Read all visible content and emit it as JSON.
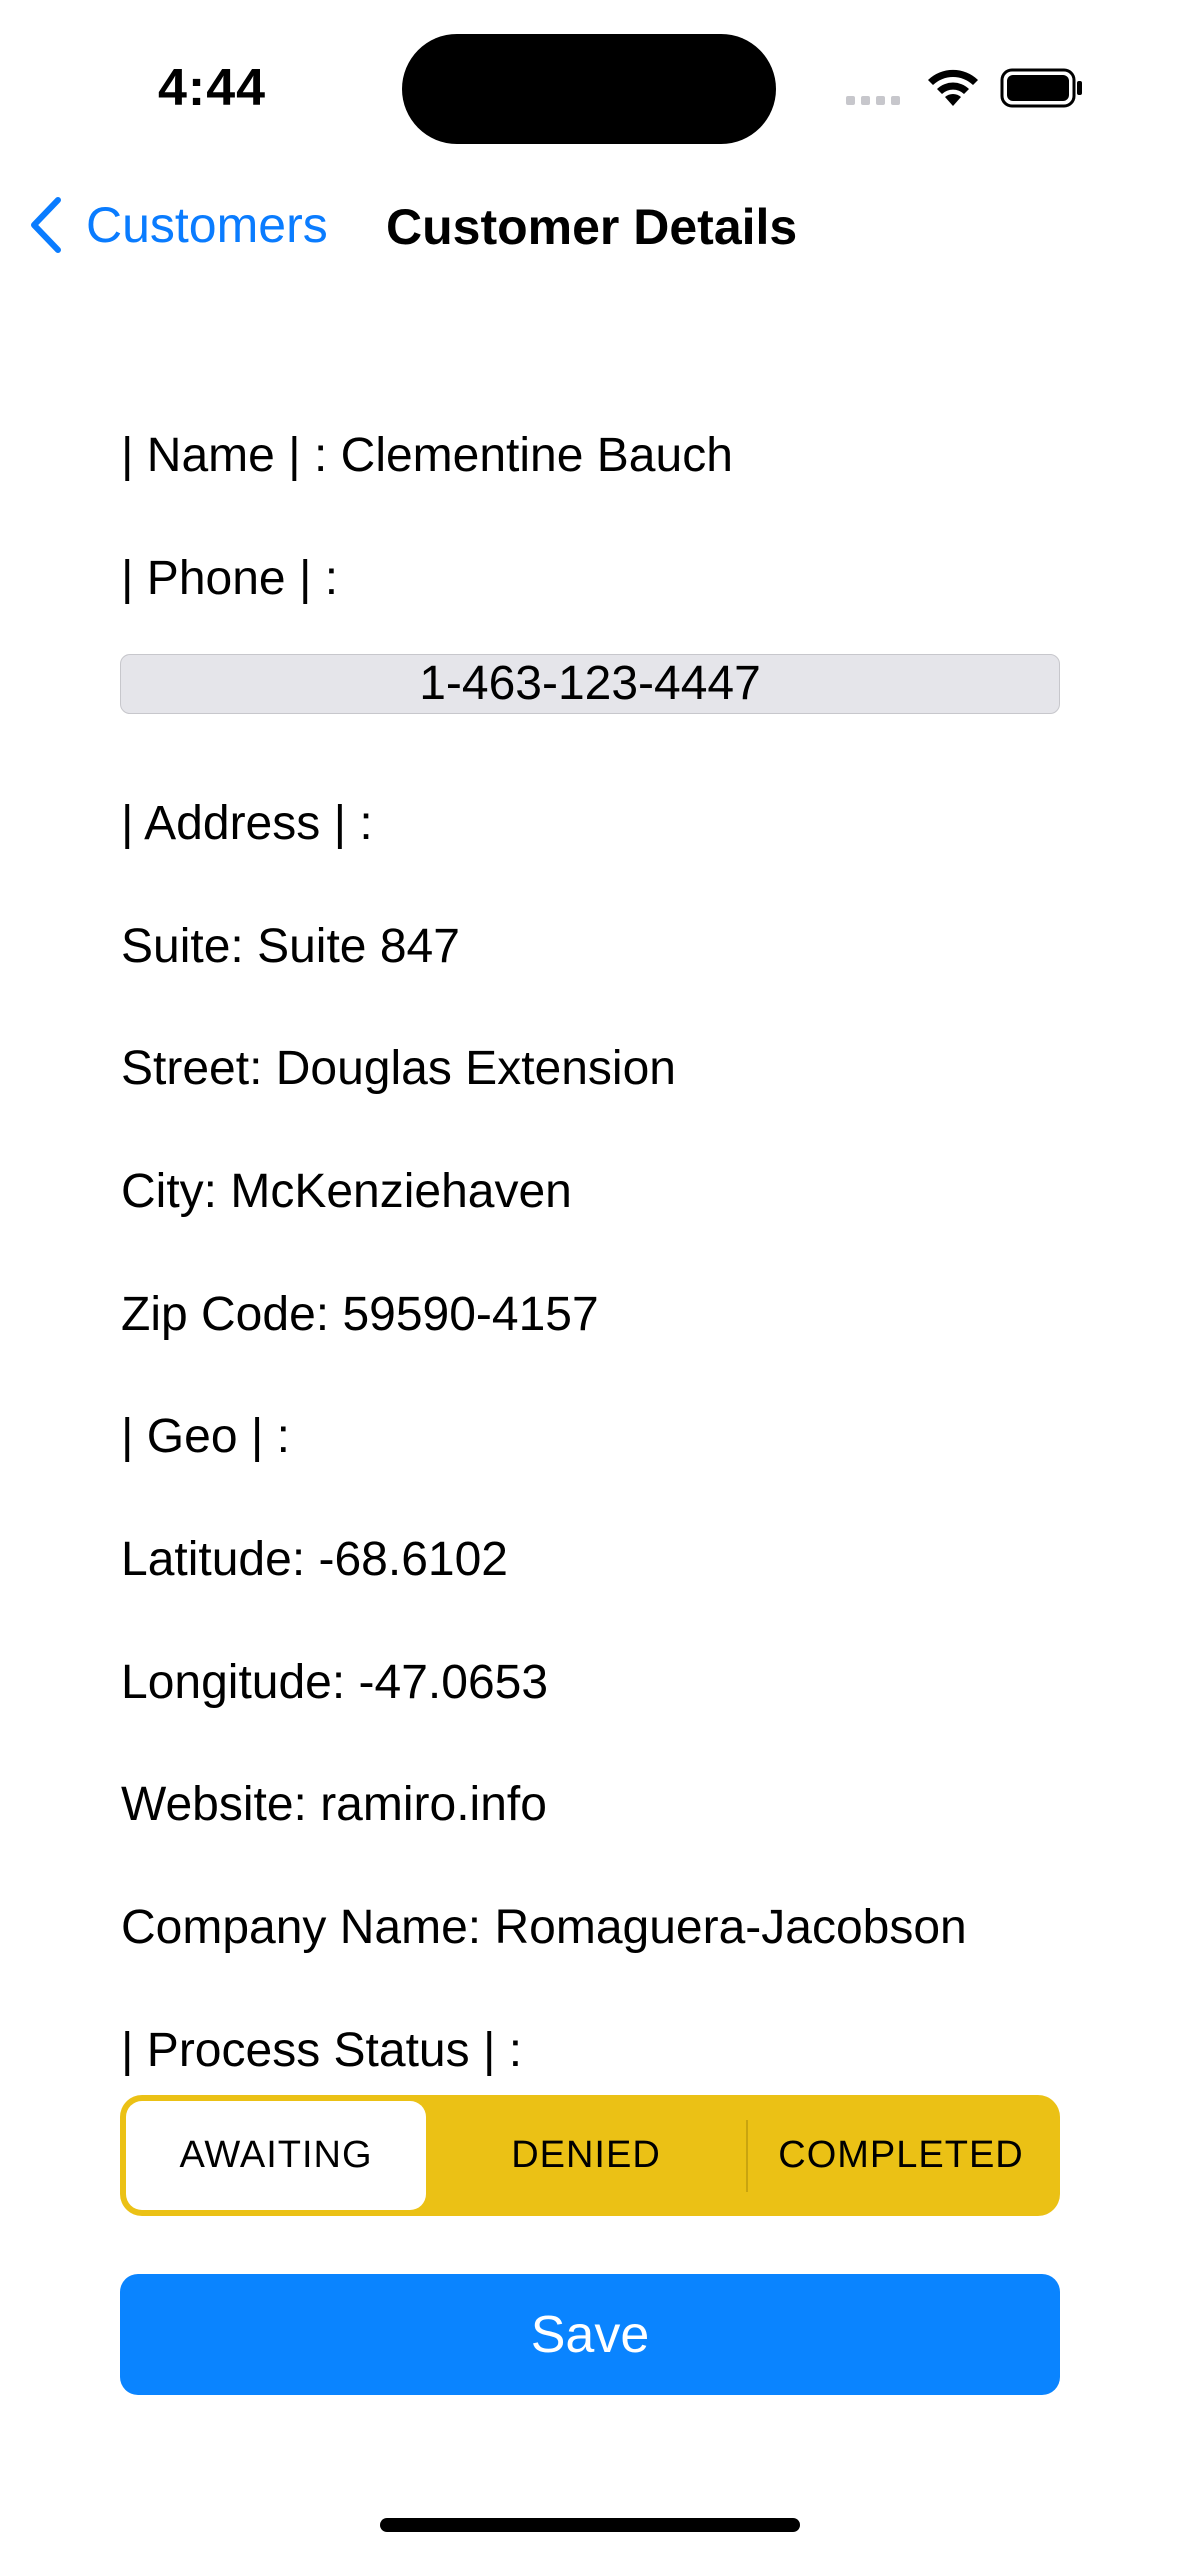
{
  "status_bar": {
    "time": "4:44"
  },
  "nav": {
    "back_label": "Customers",
    "title": "Customer Details"
  },
  "details": {
    "name_line": "| Name | : Clementine Bauch",
    "phone_label": "| Phone | :",
    "phone_value": "1-463-123-4447",
    "address_label": "| Address | :",
    "suite": "Suite: Suite 847",
    "street": "Street: Douglas Extension",
    "city": "City: McKenziehaven",
    "zip": "Zip Code: 59590-4157",
    "geo_label": "| Geo | :",
    "latitude": "Latitude: -68.6102",
    "longitude": "Longitude: -47.0653",
    "website": "Website: ramiro.info",
    "company": "Company Name: Romaguera-Jacobson",
    "process_status_label": "| Process Status | :"
  },
  "status_segments": {
    "options": [
      "AWAITING",
      "DENIED",
      "COMPLETED"
    ],
    "selected": "AWAITING",
    "color": "#ebc115"
  },
  "actions": {
    "save_label": "Save",
    "accent": "#0a84ff"
  }
}
